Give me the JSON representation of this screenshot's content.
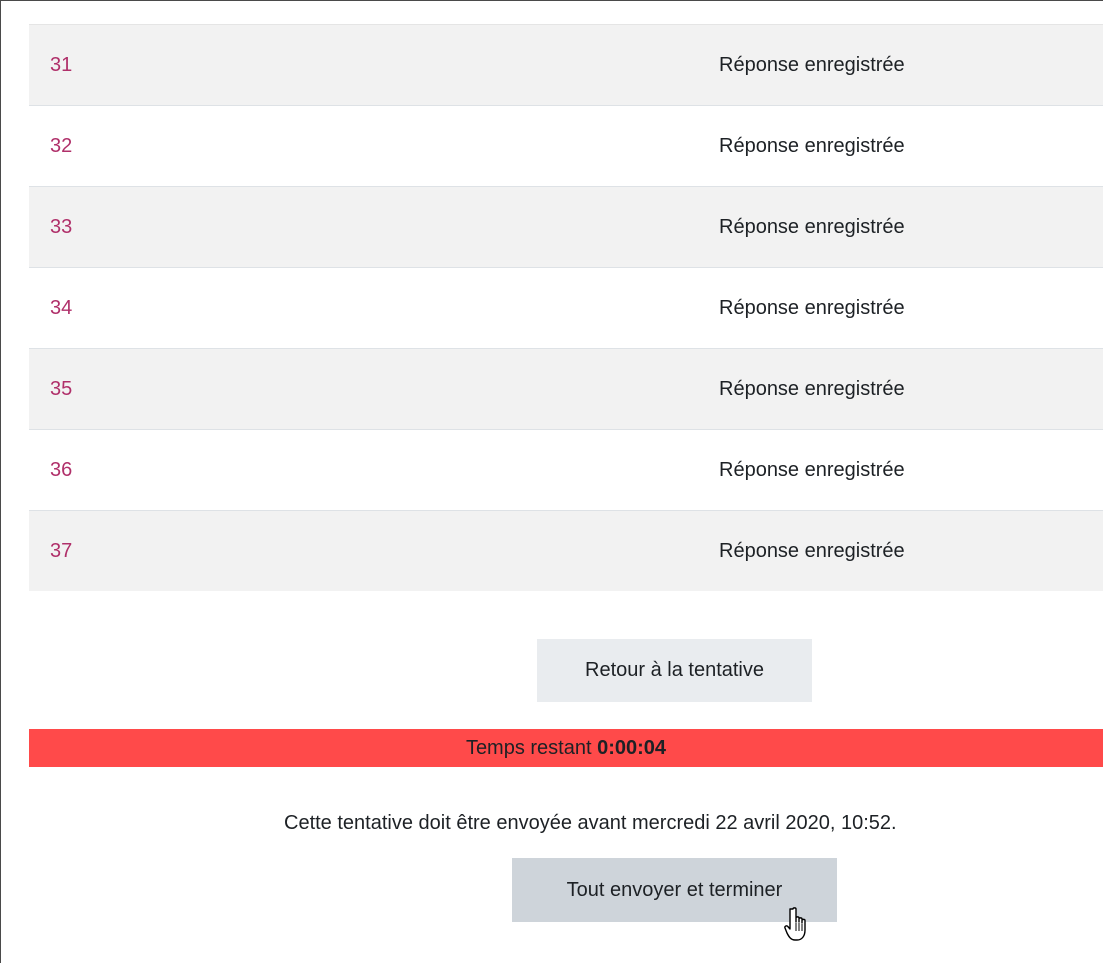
{
  "summary": {
    "rows": [
      {
        "number": "31",
        "status": "Réponse enregistrée"
      },
      {
        "number": "32",
        "status": "Réponse enregistrée"
      },
      {
        "number": "33",
        "status": "Réponse enregistrée"
      },
      {
        "number": "34",
        "status": "Réponse enregistrée"
      },
      {
        "number": "35",
        "status": "Réponse enregistrée"
      },
      {
        "number": "36",
        "status": "Réponse enregistrée"
      },
      {
        "number": "37",
        "status": "Réponse enregistrée"
      }
    ]
  },
  "actions": {
    "return_label": "Retour à la tentative",
    "submit_label": "Tout envoyer et terminer"
  },
  "timer": {
    "label": "Temps restant",
    "value": "0:00:04",
    "color": "#ff4a4a"
  },
  "deadline": {
    "text": "Cette tentative doit être envoyée avant mercredi 22 avril 2020, 10:52."
  },
  "colors": {
    "link": "#b0306a",
    "row_alt": "#f2f2f2"
  },
  "cursor": {
    "icon": "hand-pointer-icon"
  }
}
